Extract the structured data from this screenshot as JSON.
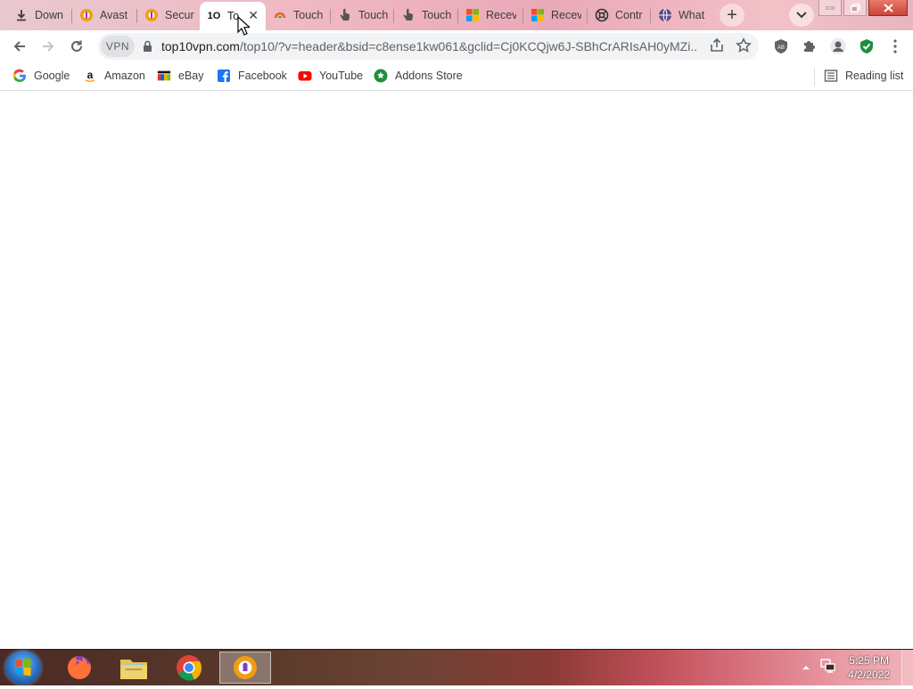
{
  "tabs": [
    {
      "title": "Down",
      "icon": "download-icon"
    },
    {
      "title": "Avast",
      "icon": "avast-secure-browser-icon"
    },
    {
      "title": "Secur",
      "icon": "avast-secure-browser-icon"
    },
    {
      "title": "To",
      "icon": "top10-logo-icon",
      "active": true
    },
    {
      "title": "Touch",
      "icon": "touch-app-icon"
    },
    {
      "title": "Touch",
      "icon": "hand-pointer-icon"
    },
    {
      "title": "Touch",
      "icon": "hand-pointer-icon"
    },
    {
      "title": "Recev",
      "icon": "microsoft-logo-icon"
    },
    {
      "title": "Recev",
      "icon": "microsoft-logo-icon"
    },
    {
      "title": "Contr",
      "icon": "support-icon"
    },
    {
      "title": "What",
      "icon": "globe-icon"
    }
  ],
  "active_tab_logo_text": "1O",
  "toolbar": {
    "vpn_label": "VPN",
    "url_host": "top10vpn.com",
    "url_rest": "/top10/?v=header&bsid=c8ense1kw061&gclid=Cj0KCQjw6J-SBhCrARIsAH0yMZi..."
  },
  "bookmarks": [
    {
      "label": "Google",
      "icon": "google-icon"
    },
    {
      "label": "Amazon",
      "icon": "amazon-icon"
    },
    {
      "label": "eBay",
      "icon": "ebay-icon"
    },
    {
      "label": "Facebook",
      "icon": "facebook-icon"
    },
    {
      "label": "YouTube",
      "icon": "youtube-icon"
    },
    {
      "label": "Addons Store",
      "icon": "addons-store-icon"
    }
  ],
  "reading_list_label": "Reading list",
  "taskbar": {
    "apps": [
      "firefox",
      "file-explorer",
      "chrome",
      "avast-secure-browser"
    ],
    "time": "5:25 PM",
    "date": "4/2/2022"
  },
  "colors": {
    "tab_strip": "#f0b8c2",
    "omnibox_bg": "#f1f3f4",
    "accent_green": "#1e8e3e"
  }
}
